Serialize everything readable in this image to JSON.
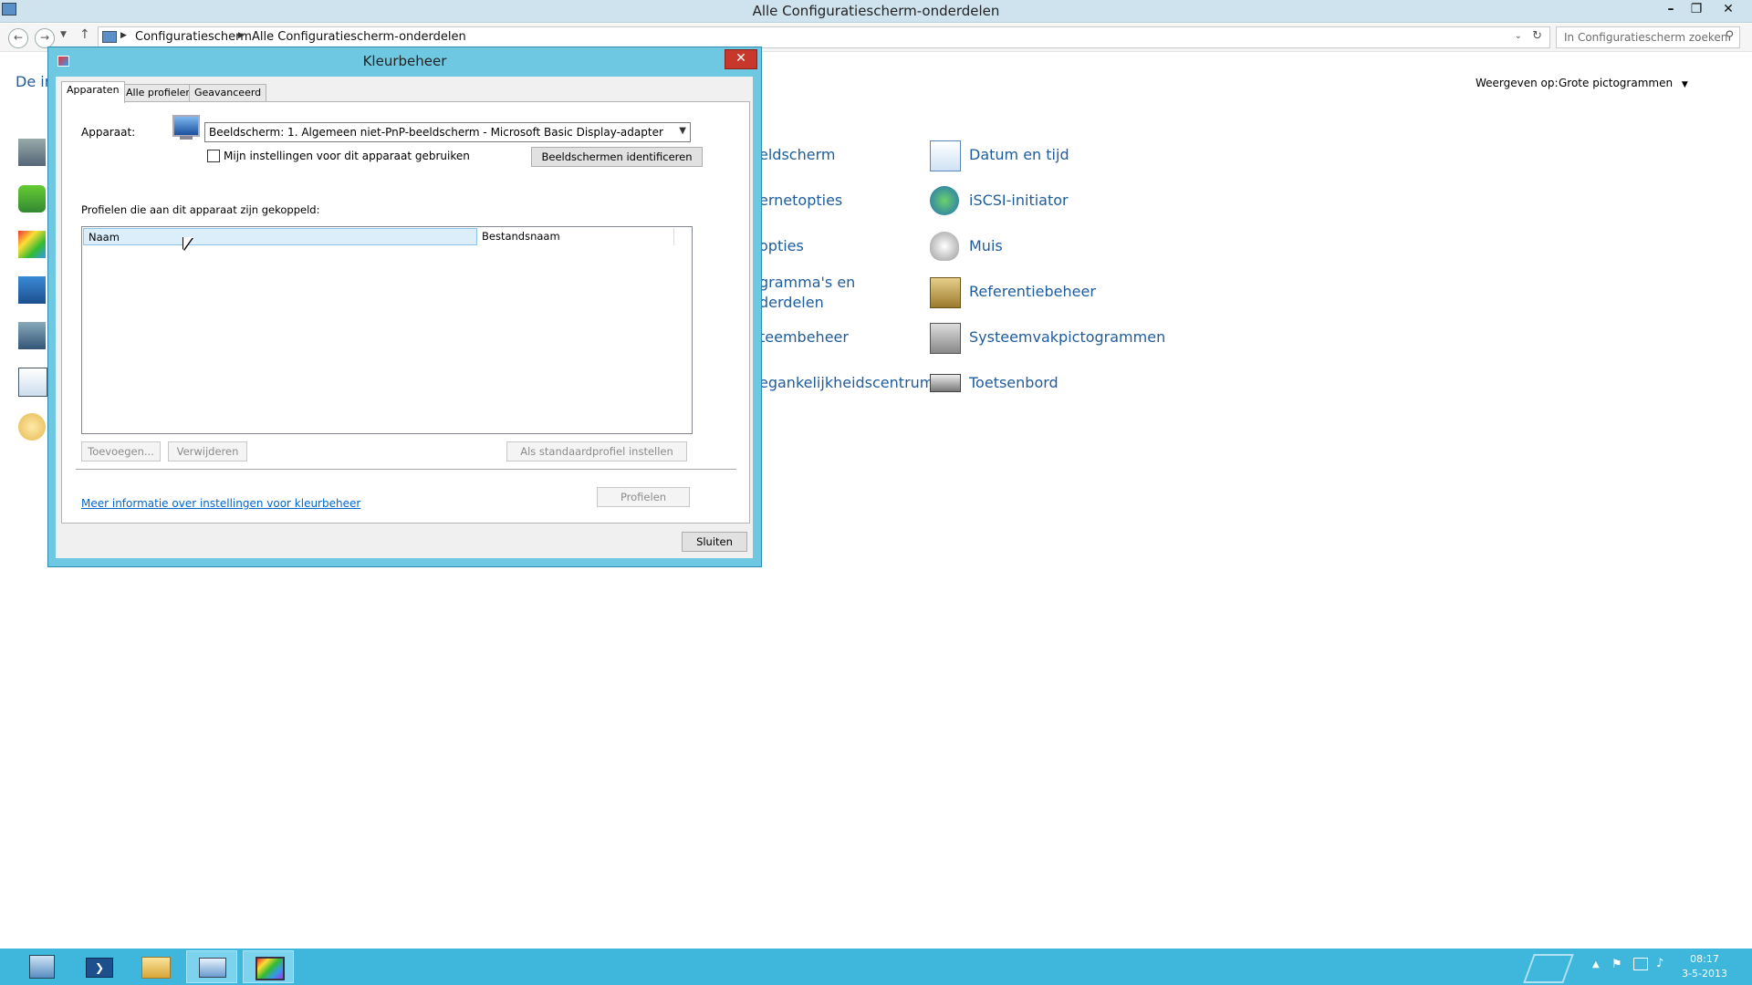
{
  "window": {
    "title": "Alle Configuratiescherm-onderdelen",
    "controls": {
      "minimize": "–",
      "restore": "❐",
      "close": "✕"
    }
  },
  "nav": {
    "breadcrumb": [
      "Configuratiescherm",
      "Alle Configuratiescherm-onderdelen"
    ],
    "search_placeholder": "In Configuratiescherm zoeken"
  },
  "content": {
    "heading_partial": "De in",
    "view_label": "Weergeven op:",
    "view_value": "Grote pictogrammen",
    "left_items_partial": [
      "eldscherm",
      "ernetopties",
      "opties",
      "gramma's en",
      "derdelen",
      "teembeheer",
      "egankelijkheidscentrum"
    ],
    "right_items": [
      "Datum en tijd",
      "iSCSI-initiator",
      "Muis",
      "Referentiebeheer",
      "Systeemvakpictogrammen",
      "Toetsenbord"
    ]
  },
  "dialog": {
    "title": "Kleurbeheer",
    "close": "✕",
    "tabs": [
      "Apparaten",
      "Alle profielen",
      "Geavanceerd"
    ],
    "device_label": "Apparaat:",
    "device_value": "Beeldscherm: 1. Algemeen niet-PnP-beeldscherm - Microsoft Basic Display-adapter",
    "checkbox_label": "Mijn instellingen voor dit apparaat gebruiken",
    "identify_button": "Beeldschermen identificeren",
    "profiles_label": "Profielen die aan dit apparaat zijn gekoppeld:",
    "columns": [
      "Naam",
      "Bestandsnaam"
    ],
    "add_button": "Toevoegen...",
    "remove_button": "Verwijderen",
    "default_button": "Als standaardprofiel instellen",
    "profiles_button": "Profielen",
    "info_link": "Meer informatie over instellingen voor kleurbeheer",
    "close_button": "Sluiten"
  },
  "taskbar": {
    "time": "08:17",
    "date": "3-5-2013"
  },
  "colors": {
    "dialog_frame": "#6fc8e2",
    "taskbar": "#3fb7dd",
    "link": "#1e5c9c"
  }
}
